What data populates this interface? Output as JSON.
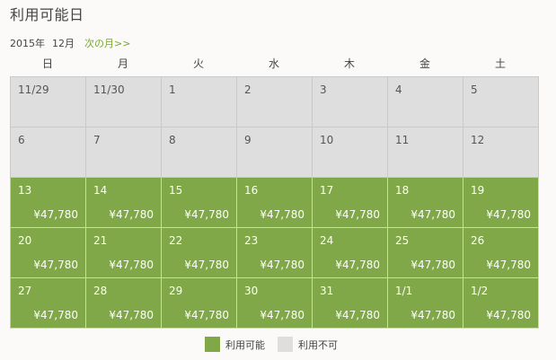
{
  "title": "利用可能日",
  "month": {
    "year": "2015年",
    "month": "12月",
    "next_link": "次の月>>"
  },
  "weekdays": [
    "日",
    "月",
    "火",
    "水",
    "木",
    "金",
    "土"
  ],
  "weeks": [
    [
      {
        "d": "11/29",
        "p": "",
        "on": false
      },
      {
        "d": "11/30",
        "p": "",
        "on": false
      },
      {
        "d": "1",
        "p": "",
        "on": false
      },
      {
        "d": "2",
        "p": "",
        "on": false
      },
      {
        "d": "3",
        "p": "",
        "on": false
      },
      {
        "d": "4",
        "p": "",
        "on": false
      },
      {
        "d": "5",
        "p": "",
        "on": false
      }
    ],
    [
      {
        "d": "6",
        "p": "",
        "on": false
      },
      {
        "d": "7",
        "p": "",
        "on": false
      },
      {
        "d": "8",
        "p": "",
        "on": false
      },
      {
        "d": "9",
        "p": "",
        "on": false
      },
      {
        "d": "10",
        "p": "",
        "on": false
      },
      {
        "d": "11",
        "p": "",
        "on": false
      },
      {
        "d": "12",
        "p": "",
        "on": false
      }
    ],
    [
      {
        "d": "13",
        "p": "¥47,780",
        "on": true
      },
      {
        "d": "14",
        "p": "¥47,780",
        "on": true
      },
      {
        "d": "15",
        "p": "¥47,780",
        "on": true
      },
      {
        "d": "16",
        "p": "¥47,780",
        "on": true
      },
      {
        "d": "17",
        "p": "¥47,780",
        "on": true
      },
      {
        "d": "18",
        "p": "¥47,780",
        "on": true
      },
      {
        "d": "19",
        "p": "¥47,780",
        "on": true
      }
    ],
    [
      {
        "d": "20",
        "p": "¥47,780",
        "on": true
      },
      {
        "d": "21",
        "p": "¥47,780",
        "on": true
      },
      {
        "d": "22",
        "p": "¥47,780",
        "on": true
      },
      {
        "d": "23",
        "p": "¥47,780",
        "on": true
      },
      {
        "d": "24",
        "p": "¥47,780",
        "on": true
      },
      {
        "d": "25",
        "p": "¥47,780",
        "on": true
      },
      {
        "d": "26",
        "p": "¥47,780",
        "on": true
      }
    ],
    [
      {
        "d": "27",
        "p": "¥47,780",
        "on": true
      },
      {
        "d": "28",
        "p": "¥47,780",
        "on": true
      },
      {
        "d": "29",
        "p": "¥47,780",
        "on": true
      },
      {
        "d": "30",
        "p": "¥47,780",
        "on": true
      },
      {
        "d": "31",
        "p": "¥47,780",
        "on": true
      },
      {
        "d": "1/1",
        "p": "¥47,780",
        "on": true
      },
      {
        "d": "1/2",
        "p": "¥47,780",
        "on": true
      }
    ]
  ],
  "legend": {
    "available": "利用可能",
    "unavailable": "利用不可"
  },
  "colors": {
    "available": "#80a848",
    "unavailable": "#dedede",
    "link": "#7aa732"
  }
}
